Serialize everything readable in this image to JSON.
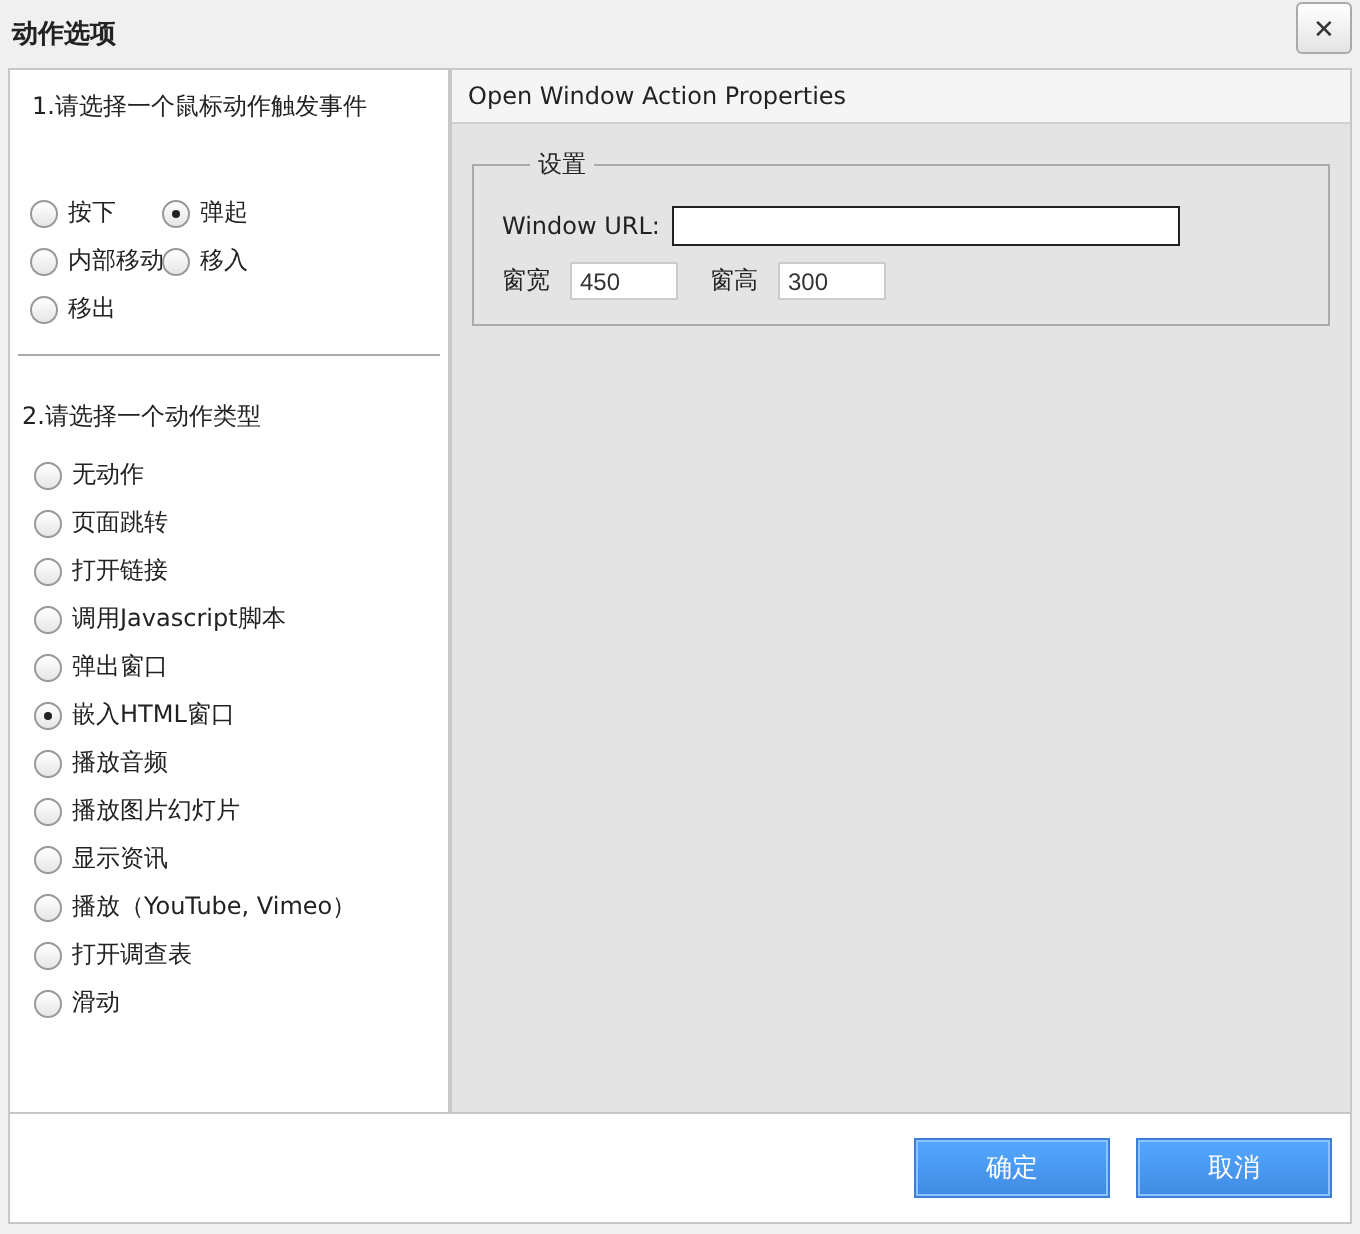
{
  "window": {
    "title": "动作选项",
    "close": "✕"
  },
  "event_section": {
    "heading": "1.请选择一个鼠标动作触发事件",
    "options": [
      {
        "label": "按下",
        "selected": false
      },
      {
        "label": "弹起",
        "selected": true
      },
      {
        "label": "内部移动",
        "selected": false
      },
      {
        "label": "移入",
        "selected": false
      },
      {
        "label": "移出",
        "selected": false
      }
    ]
  },
  "action_section": {
    "heading": "2.请选择一个动作类型",
    "options": [
      {
        "label": "无动作",
        "selected": false
      },
      {
        "label": "页面跳转",
        "selected": false
      },
      {
        "label": "打开链接",
        "selected": false
      },
      {
        "label": "调用Javascript脚本",
        "selected": false
      },
      {
        "label": "弹出窗口",
        "selected": false
      },
      {
        "label": "嵌入HTML窗口",
        "selected": true
      },
      {
        "label": "播放音频",
        "selected": false
      },
      {
        "label": "播放图片幻灯片",
        "selected": false
      },
      {
        "label": "显示资讯",
        "selected": false
      },
      {
        "label": "播放（YouTube, Vimeo）",
        "selected": false
      },
      {
        "label": "打开调查表",
        "selected": false
      },
      {
        "label": "滑动",
        "selected": false
      }
    ]
  },
  "properties": {
    "title": "Open Window Action Properties",
    "group": "设置",
    "url_label": "Window URL:",
    "width_label": "窗宽",
    "width_value": "450",
    "height_label": "窗高",
    "height_value": "300"
  },
  "buttons": [
    "确定",
    "取消"
  ]
}
